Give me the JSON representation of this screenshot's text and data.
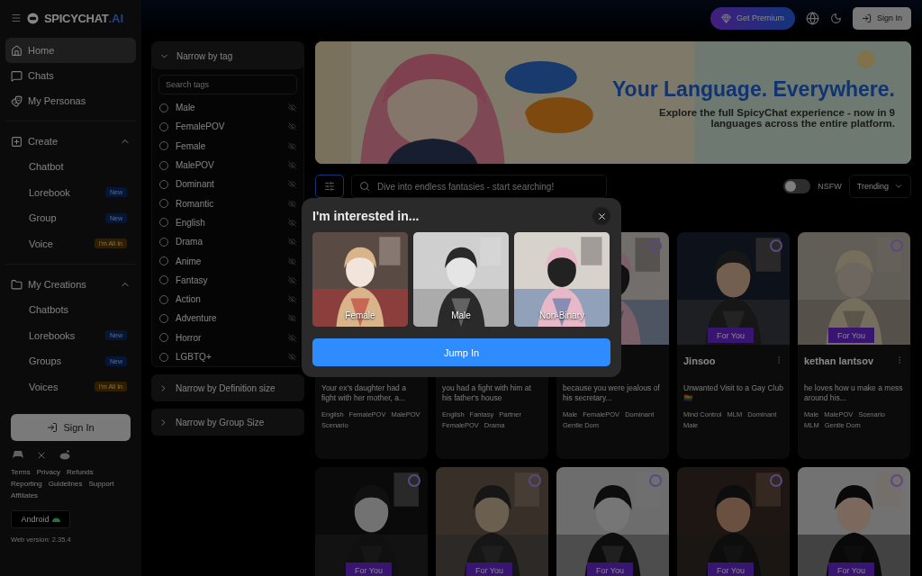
{
  "header": {
    "logo": "SPICYCHAT",
    "logo_suffix": ".AI",
    "premium": "Get Premium",
    "sign_in": "Sign In"
  },
  "sidebar": {
    "nav": [
      {
        "label": "Home",
        "selected": true
      },
      {
        "label": "Chats",
        "selected": false
      },
      {
        "label": "My Personas",
        "selected": false
      }
    ],
    "groups": [
      {
        "label": "Create",
        "expanded": true,
        "children": [
          {
            "label": "Chatbot"
          },
          {
            "label": "Lorebook",
            "badge": {
              "text": "New",
              "kind": "new"
            }
          },
          {
            "label": "Group",
            "badge": {
              "text": "New",
              "kind": "new"
            }
          },
          {
            "label": "Voice",
            "badge": {
              "text": "I'm All In",
              "kind": "tier"
            }
          }
        ]
      },
      {
        "label": "My Creations",
        "expanded": true,
        "children": [
          {
            "label": "Chatbots"
          },
          {
            "label": "Lorebooks",
            "badge": {
              "text": "New",
              "kind": "new"
            }
          },
          {
            "label": "Groups",
            "badge": {
              "text": "New",
              "kind": "new"
            }
          },
          {
            "label": "Voices",
            "badge": {
              "text": "I'm All In",
              "kind": "tier"
            }
          }
        ]
      }
    ],
    "sign_in": "Sign In",
    "links": [
      "Terms",
      "Privacy",
      "Refunds",
      "Reporting",
      "Guidelines",
      "Support",
      "Affiliates"
    ],
    "store": "Android",
    "version": "Web version: 2.35.4"
  },
  "tag_filter": {
    "title": "Narrow by tag",
    "expanded": true,
    "placeholder": "Search tags",
    "tags": [
      {
        "label": "Male",
        "checked": false
      },
      {
        "label": "FemalePOV",
        "checked": false
      },
      {
        "label": "Female",
        "checked": false
      },
      {
        "label": "MalePOV",
        "checked": false
      },
      {
        "label": "Dominant",
        "checked": false
      },
      {
        "label": "Romantic",
        "checked": false
      },
      {
        "label": "English",
        "checked": false
      },
      {
        "label": "Drama",
        "checked": false
      },
      {
        "label": "Anime",
        "checked": false
      },
      {
        "label": "Fantasy",
        "checked": false
      },
      {
        "label": "Action",
        "checked": false
      },
      {
        "label": "Adventure",
        "checked": false
      },
      {
        "label": "Horror",
        "checked": false
      },
      {
        "label": "LGBTQ+",
        "checked": false
      }
    ]
  },
  "other_filters": [
    {
      "title": "Narrow by Definition size",
      "expanded": false
    },
    {
      "title": "Narrow by Group Size",
      "expanded": false
    }
  ],
  "banner": {
    "headline": "Your Language. Everywhere.",
    "subline": "Explore the full SpicyChat experience - now in 9 languages across the entire platform."
  },
  "toolbar": {
    "placeholder": "Dive into endless fantasies - start searching!",
    "nsfw": {
      "label": "NSFW",
      "on": false
    },
    "sort": "Trending"
  },
  "cards": [
    {
      "description": "Your ex's daughter had a fight with her mother, a...",
      "tags": [
        "English",
        "FemalePOV",
        "MalePOV",
        "Scenario"
      ]
    },
    {
      "description": "you had a fight with him at his father's house",
      "tags": [
        "English",
        "Fantasy",
        "Partner",
        "FemalePOV",
        "Drama"
      ]
    },
    {
      "description": "because you were jealous of his secretary...",
      "tags": [
        "Male",
        "FemalePOV",
        "Dominant",
        "Gentle Dom"
      ]
    },
    {
      "title": "Jinsoo",
      "badge": "For You",
      "description": "Unwanted Visit to a Gay Club🏳️‍🌈",
      "tags": [
        "Mind Control",
        "MLM",
        "Dominant",
        "Male"
      ]
    },
    {
      "title": "kethan lantsov",
      "badge": "For You",
      "description": "he loves how u make a mess around his...",
      "tags": [
        "Male",
        "MalePOV",
        "Scenario",
        "MLM",
        "Gentle Dom"
      ]
    },
    {
      "badge": "For You"
    },
    {
      "badge": "For You"
    },
    {
      "badge": "For You"
    },
    {
      "badge": "For You"
    },
    {
      "badge": "For You"
    }
  ],
  "modal": {
    "title": "I'm interested in...",
    "options": [
      {
        "label": "Female",
        "selected": false
      },
      {
        "label": "Male",
        "selected": false
      },
      {
        "label": "Non-Binary",
        "selected": false
      }
    ],
    "button": "Jump In"
  }
}
